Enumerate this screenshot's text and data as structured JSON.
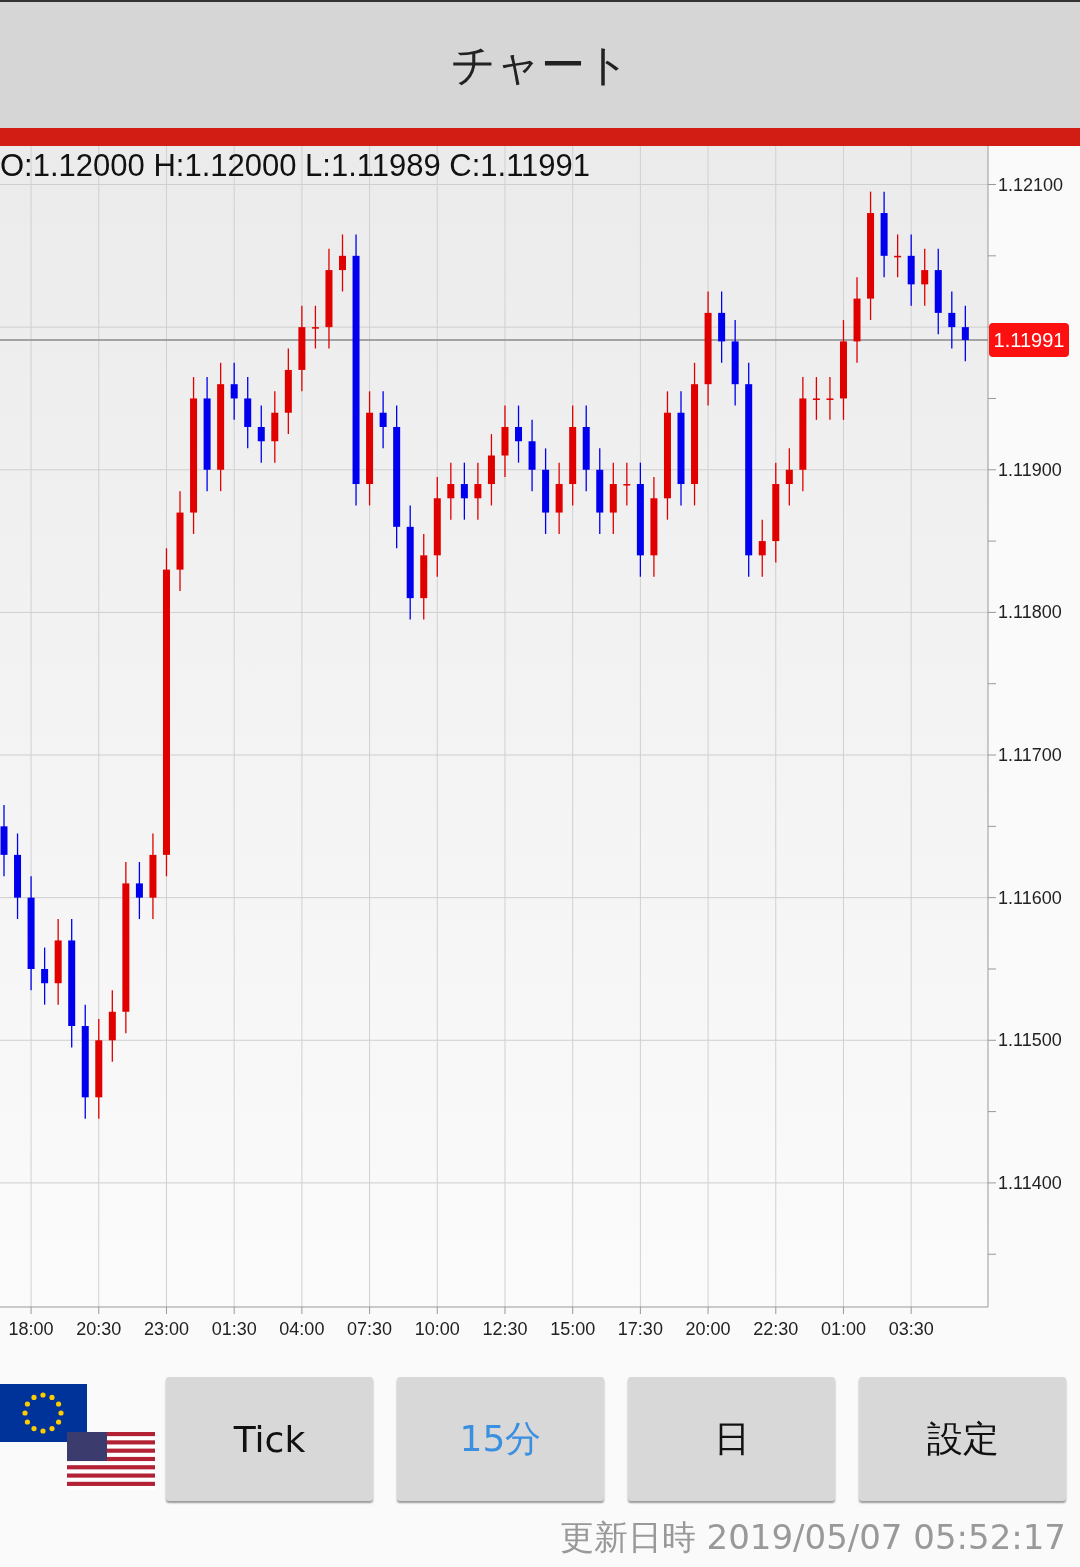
{
  "header": {
    "title": "チャート"
  },
  "ohlc": "O:1.12000 H:1.12000 L:1.11989 C:1.11991",
  "chart": {
    "chart_data": {
      "type": "candlestick",
      "ylim": [
        1.11313,
        1.12127
      ],
      "grid": true,
      "categories": [
        null,
        null,
        "18:00",
        null,
        null,
        null,
        null,
        "20:30",
        null,
        null,
        null,
        null,
        "23:00",
        null,
        null,
        null,
        null,
        "01:30",
        null,
        null,
        null,
        null,
        "04:00",
        null,
        null,
        null,
        null,
        "07:30",
        null,
        null,
        null,
        null,
        "10:00",
        null,
        null,
        null,
        null,
        "12:30",
        null,
        null,
        null,
        null,
        "15:00",
        null,
        null,
        null,
        null,
        "17:30",
        null,
        null,
        null,
        null,
        "20:00",
        null,
        null,
        null,
        null,
        "22:30",
        null,
        null,
        null,
        null,
        "01:00",
        null,
        null,
        null,
        null,
        "03:30",
        null,
        null,
        null,
        null
      ],
      "yticks": [
        {
          "value": 1.121,
          "label": "1.12100"
        },
        {
          "value": 1.119,
          "label": "1.11900"
        },
        {
          "value": 1.118,
          "label": "1.11800"
        },
        {
          "value": 1.117,
          "label": "1.11700"
        },
        {
          "value": 1.116,
          "label": "1.11600"
        },
        {
          "value": 1.115,
          "label": "1.11500"
        },
        {
          "value": 1.114,
          "label": "1.11400"
        }
      ],
      "ref_lines": [
        {
          "axis": "y",
          "value": 1.11991,
          "label": "1.11991",
          "color": "#8a8a8a"
        }
      ],
      "ohlc": [
        [
          1.1165,
          1.11665,
          1.11615,
          1.1163
        ],
        [
          1.1163,
          1.11645,
          1.11585,
          1.116
        ],
        [
          1.116,
          1.11615,
          1.11535,
          1.1155
        ],
        [
          1.1155,
          1.11565,
          1.11525,
          1.1154
        ],
        [
          1.1154,
          1.11585,
          1.11525,
          1.1157
        ],
        [
          1.1157,
          1.11585,
          1.11495,
          1.1151
        ],
        [
          1.1151,
          1.11525,
          1.11445,
          1.1146
        ],
        [
          1.1146,
          1.11515,
          1.11445,
          1.115
        ],
        [
          1.115,
          1.11535,
          1.11485,
          1.1152
        ],
        [
          1.1152,
          1.11625,
          1.11505,
          1.1161
        ],
        [
          1.1161,
          1.11625,
          1.11585,
          1.116
        ],
        [
          1.116,
          1.11645,
          1.11585,
          1.1163
        ],
        [
          1.1163,
          1.11845,
          1.11615,
          1.1183
        ],
        [
          1.1183,
          1.11885,
          1.11815,
          1.1187
        ],
        [
          1.1187,
          1.11965,
          1.11855,
          1.1195
        ],
        [
          1.1195,
          1.11965,
          1.11885,
          1.119
        ],
        [
          1.119,
          1.11975,
          1.11885,
          1.1196
        ],
        [
          1.1196,
          1.11975,
          1.11935,
          1.1195
        ],
        [
          1.1195,
          1.11965,
          1.11915,
          1.1193
        ],
        [
          1.1193,
          1.11945,
          1.11905,
          1.1192
        ],
        [
          1.1192,
          1.11955,
          1.11905,
          1.1194
        ],
        [
          1.1194,
          1.11985,
          1.11925,
          1.1197
        ],
        [
          1.1197,
          1.12015,
          1.11955,
          1.12
        ],
        [
          1.12,
          1.12015,
          1.11985,
          1.12
        ],
        [
          1.12,
          1.12055,
          1.11985,
          1.1204
        ],
        [
          1.1204,
          1.12065,
          1.12025,
          1.1205
        ],
        [
          1.1205,
          1.12065,
          1.11875,
          1.1189
        ],
        [
          1.1189,
          1.11955,
          1.11875,
          1.1194
        ],
        [
          1.1194,
          1.11955,
          1.11915,
          1.1193
        ],
        [
          1.1193,
          1.11945,
          1.11845,
          1.1186
        ],
        [
          1.1186,
          1.11875,
          1.11795,
          1.1181
        ],
        [
          1.1181,
          1.11855,
          1.11795,
          1.1184
        ],
        [
          1.1184,
          1.11895,
          1.11825,
          1.1188
        ],
        [
          1.1188,
          1.11905,
          1.11865,
          1.1189
        ],
        [
          1.1189,
          1.11905,
          1.11865,
          1.1188
        ],
        [
          1.1188,
          1.11905,
          1.11865,
          1.1189
        ],
        [
          1.1189,
          1.11925,
          1.11875,
          1.1191
        ],
        [
          1.1191,
          1.11945,
          1.11895,
          1.1193
        ],
        [
          1.1193,
          1.11945,
          1.11905,
          1.1192
        ],
        [
          1.1192,
          1.11935,
          1.11885,
          1.119
        ],
        [
          1.119,
          1.11915,
          1.11855,
          1.1187
        ],
        [
          1.1187,
          1.11905,
          1.11855,
          1.1189
        ],
        [
          1.1189,
          1.11945,
          1.11875,
          1.1193
        ],
        [
          1.1193,
          1.11945,
          1.11885,
          1.119
        ],
        [
          1.119,
          1.11915,
          1.11855,
          1.1187
        ],
        [
          1.1187,
          1.11905,
          1.11855,
          1.1189
        ],
        [
          1.1189,
          1.11905,
          1.11875,
          1.1189
        ],
        [
          1.1189,
          1.11905,
          1.11825,
          1.1184
        ],
        [
          1.1184,
          1.11895,
          1.11825,
          1.1188
        ],
        [
          1.1188,
          1.11955,
          1.11865,
          1.1194
        ],
        [
          1.1194,
          1.11955,
          1.11875,
          1.1189
        ],
        [
          1.1189,
          1.11975,
          1.11875,
          1.1196
        ],
        [
          1.1196,
          1.12025,
          1.11945,
          1.1201
        ],
        [
          1.1201,
          1.12025,
          1.11975,
          1.1199
        ],
        [
          1.1199,
          1.12005,
          1.11945,
          1.1196
        ],
        [
          1.1196,
          1.11975,
          1.11825,
          1.1184
        ],
        [
          1.1184,
          1.11865,
          1.11825,
          1.1185
        ],
        [
          1.1185,
          1.11905,
          1.11835,
          1.1189
        ],
        [
          1.1189,
          1.11915,
          1.11875,
          1.119
        ],
        [
          1.119,
          1.11965,
          1.11885,
          1.1195
        ],
        [
          1.1195,
          1.11965,
          1.11935,
          1.1195
        ],
        [
          1.1195,
          1.11965,
          1.11935,
          1.1195
        ],
        [
          1.1195,
          1.12005,
          1.11935,
          1.1199
        ],
        [
          1.1199,
          1.12035,
          1.11975,
          1.1202
        ],
        [
          1.1202,
          1.12095,
          1.12005,
          1.1208
        ],
        [
          1.1208,
          1.12095,
          1.12035,
          1.1205
        ],
        [
          1.1205,
          1.12065,
          1.12035,
          1.1205
        ],
        [
          1.1205,
          1.12065,
          1.12015,
          1.1203
        ],
        [
          1.1203,
          1.12055,
          1.12015,
          1.1204
        ],
        [
          1.1204,
          1.12055,
          1.11995,
          1.1201
        ],
        [
          1.1201,
          1.12025,
          1.11985,
          1.12
        ],
        [
          1.12,
          1.12015,
          1.11976,
          1.11991
        ]
      ]
    }
  },
  "buttons": [
    {
      "label": "Tick",
      "selected": false
    },
    {
      "label": "15分",
      "selected": true
    },
    {
      "label": "日",
      "selected": false
    },
    {
      "label": "設定",
      "selected": false
    }
  ],
  "updated": "更新日時 2019/05/07 05:52:17"
}
